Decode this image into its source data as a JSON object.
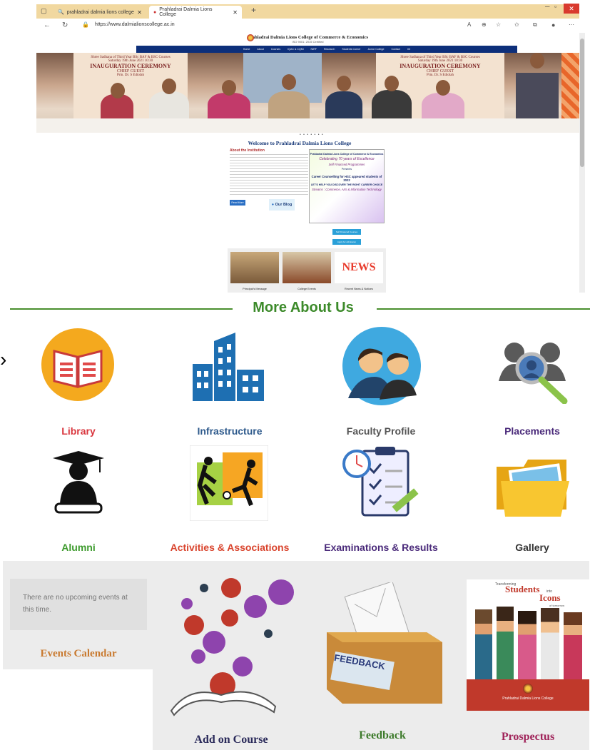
{
  "browser": {
    "tabs": [
      {
        "label": "prahladrai dalmia lions college"
      },
      {
        "label": "Prahladrai Dalmia Lions College"
      }
    ],
    "new_tab": "+",
    "url": "https://www.dalmialionscollege.ac.in",
    "close": "✕"
  },
  "site": {
    "title": "Prahladrai Dalmia Lions College of Commerce & Economics",
    "subtitle": "ISO 9001: 2015 Certified",
    "nav": [
      "Home",
      "About",
      "Courses",
      "IQAC & CQMi",
      "NIRF",
      "Research",
      "Students Corner",
      "Junior College",
      "Contact"
    ],
    "banner": {
      "board_lines": [
        "Shree Sadhana of Third Year BSc BAF & BSC Courses",
        "Saturday 19th June 2021 10:30",
        "INAUGURATION CEREMONY",
        "CHIEF GUEST",
        "Prin. Dr. S Ediolah"
      ],
      "board_title": "INAUGURATION CEREMONY",
      "board_sub": "CHIEF GUEST",
      "carousel_dots": "• • • • • • •"
    },
    "welcome": "Welcome to Prahladrai Dalmia Lions College",
    "about_title": "About the Institution",
    "read_more": "Read More",
    "blog": "Our Blog",
    "poster": {
      "title": "Prahladrai Dalmia Lions College of Commerce & Economics",
      "tagline": "Celebrating 70 years of Excellence",
      "programmes": "Self Financed Programmes",
      "presents": "Presents",
      "counselling": "Career Counselling for HSC appeared students of 2022",
      "lets": "LET'S HELP YOU DISCOVER THE RIGHT CAREER CHOICE",
      "streams": "Streams : Commerce, Arts & Information Technology"
    },
    "buttons": [
      "Self Financed Courses",
      "Apply for Admission"
    ],
    "cards": [
      {
        "caption": "Principal's Message"
      },
      {
        "caption": "College Events"
      },
      {
        "caption": "Recent News & Notices"
      }
    ],
    "news_word": "NEWS"
  },
  "more_about": {
    "heading": "More About Us",
    "items": [
      {
        "label": "Library",
        "color": "#d9363e"
      },
      {
        "label": "Infrastructure",
        "color": "#2e5a8c"
      },
      {
        "label": "Faculty Profile",
        "color": "#555555"
      },
      {
        "label": "Placements",
        "color": "#4a2a7a"
      },
      {
        "label": "Alumni",
        "color": "#3c9a2c"
      },
      {
        "label": "Activities & Associations",
        "color": "#d9432c"
      },
      {
        "label": "Examinations & Results",
        "color": "#4a2a7a"
      },
      {
        "label": "Gallery",
        "color": "#333333"
      }
    ]
  },
  "bottom": {
    "events_text": "There are no upcoming events at this time.",
    "events_label": "Events Calendar",
    "addon_label": "Add on Course",
    "feedback_label": "Feedback",
    "feedback_word": "FEEDBACK",
    "prospectus_label": "Prospectus",
    "prospectus_head1": "Transforming",
    "prospectus_head2": "Students",
    "prospectus_head3": "into",
    "prospectus_head4": "Icons",
    "prospectus_head5": "of tomorrow",
    "prospectus_footer": "Prahladrai Dalmia Lions College"
  }
}
